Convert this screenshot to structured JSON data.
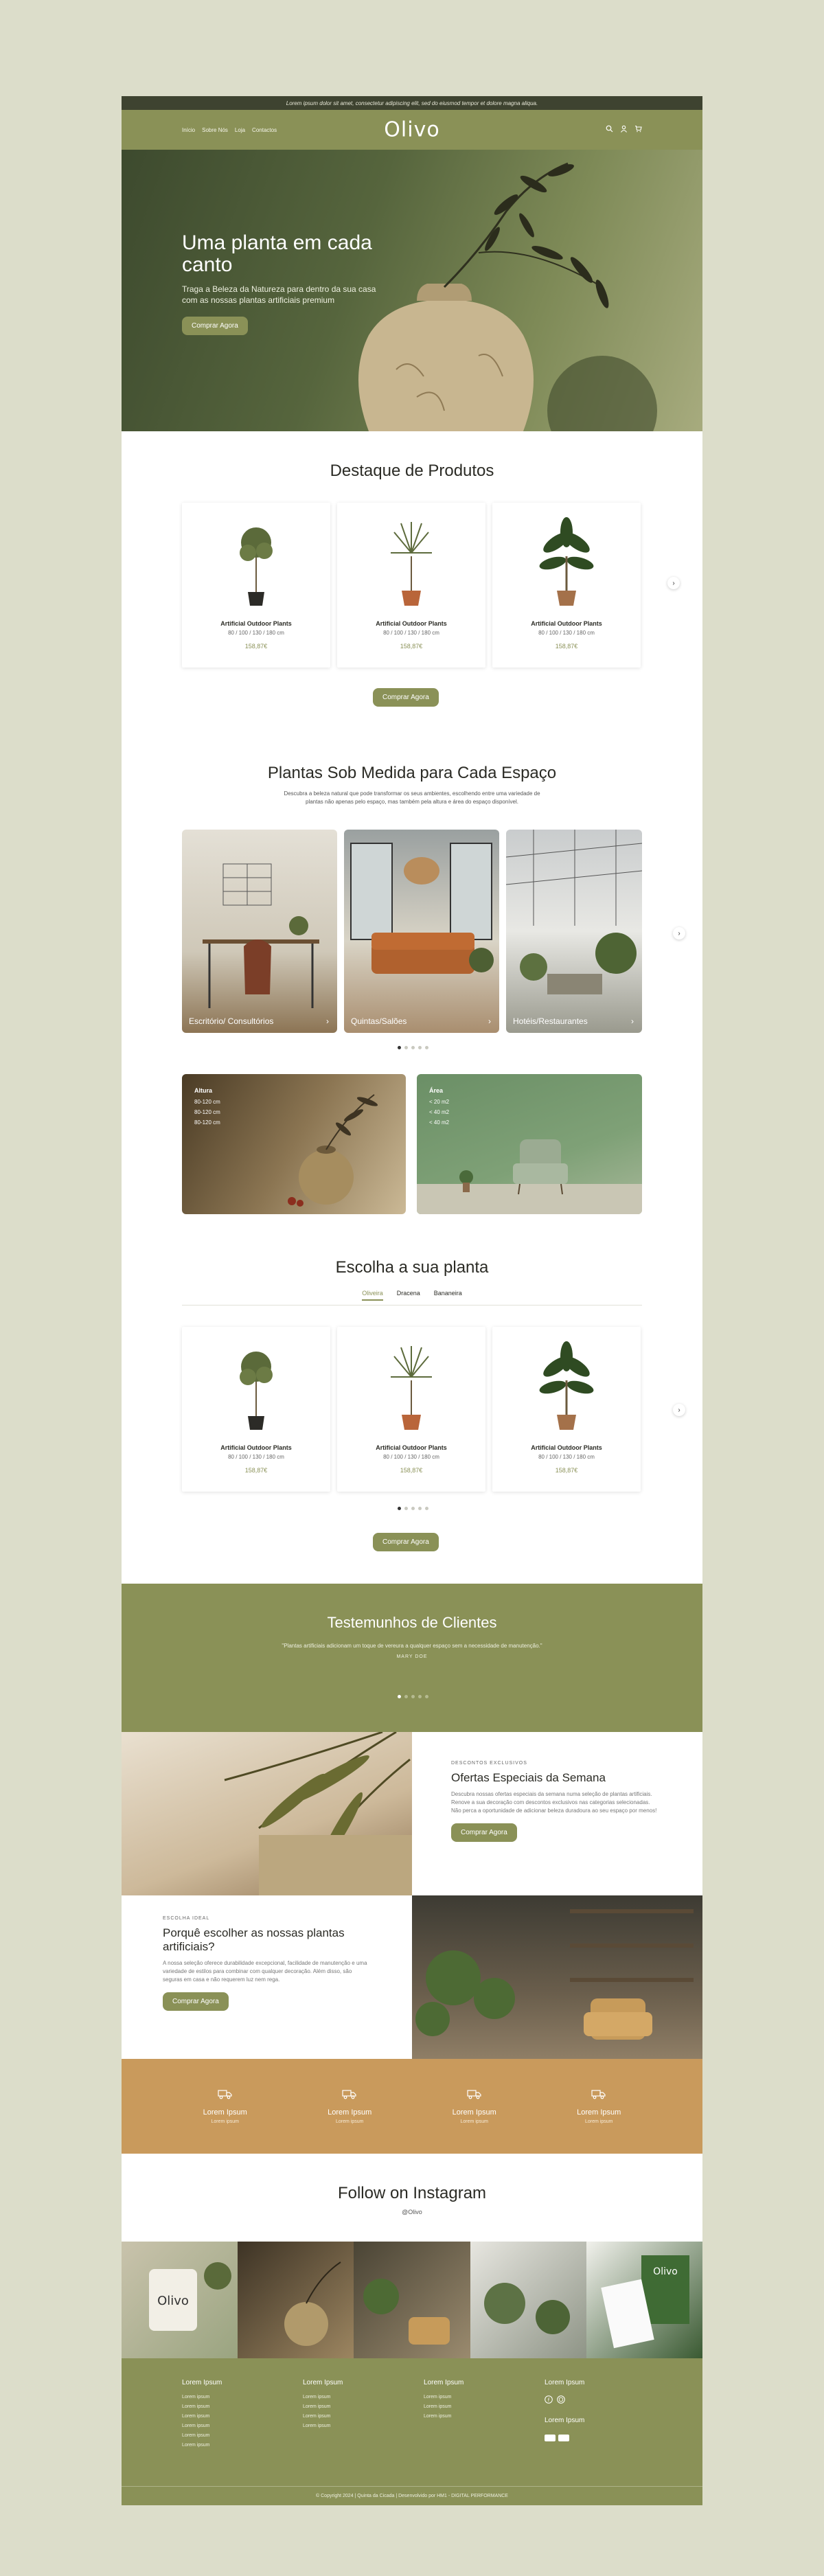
{
  "topbar": {
    "text": "Lorem ipsum dolor sit amet, consectetur adipiscing elit, sed do eiusmod tempor et dolore magna aliqua."
  },
  "nav": {
    "links": [
      "Início",
      "Sobre Nós",
      "Loja",
      "Contactos"
    ],
    "logo": "Olivo",
    "icons": [
      "search-icon",
      "user-icon",
      "cart-icon"
    ]
  },
  "hero": {
    "title": "Uma planta em cada canto",
    "subtitle": "Traga a Beleza da Natureza para dentro da sua casa com as nossas plantas artificiais premium",
    "cta": "Comprar Agora"
  },
  "featured": {
    "title": "Destaque de Produtos",
    "products": [
      {
        "name": "Artificial Outdoor Plants",
        "sizes": "80 / 100 / 130 / 180 cm",
        "price": "158,87€"
      },
      {
        "name": "Artificial Outdoor Plants",
        "sizes": "80 / 100 / 130 / 180 cm",
        "price": "158,87€"
      },
      {
        "name": "Artificial Outdoor Plants",
        "sizes": "80 / 100 / 130 / 180 cm",
        "price": "158,87€"
      }
    ],
    "cta": "Comprar Agora"
  },
  "spaces": {
    "title": "Plantas Sob Medida para Cada Espaço",
    "subtitle": "Descubra a beleza natural que pode transformar os seus ambientes, escolhendo entre uma variedade de plantas não apenas pelo espaço, mas também pela altura e área do espaço disponível.",
    "cards": [
      "Escritório/ Consultórios",
      "Quintas/Salões",
      "Hotéis/Restaurantes"
    ]
  },
  "filters": {
    "height": {
      "title": "Altura",
      "items": [
        "80-120 cm",
        "80-120 cm",
        "80-120 cm"
      ]
    },
    "area": {
      "title": "Área",
      "items": [
        "< 20 m2",
        "< 40 m2",
        "< 40 m2"
      ]
    }
  },
  "choose": {
    "title": "Escolha a sua planta",
    "tabs": [
      "Oliveira",
      "Dracena",
      "Bananeira"
    ],
    "products": [
      {
        "name": "Artificial Outdoor Plants",
        "sizes": "80 / 100 / 130 / 180 cm",
        "price": "158,87€"
      },
      {
        "name": "Artificial Outdoor Plants",
        "sizes": "80 / 100 / 130 / 180 cm",
        "price": "158,87€"
      },
      {
        "name": "Artificial Outdoor Plants",
        "sizes": "80 / 100 / 130 / 180 cm",
        "price": "158,87€"
      }
    ],
    "cta": "Comprar Agora"
  },
  "testimonials": {
    "title": "Testemunhos de Clientes",
    "quote": "\"Plantas artificiais adicionam um toque de vereura a qualquer espaço sem a necessidade de manutenção.\"",
    "author": "MARY DOE"
  },
  "offers": {
    "kicker": "DESCONTOS EXCLUSIVOS",
    "title": "Ofertas Especiais da Semana",
    "desc": "Descubra nossas ofertas especiais da semana numa seleção de plantas artificiais. Renove a sua decoração com descontos exclusivos nas categorias selecionadas. Não perca a oportunidade de adicionar beleza duradoura ao seu espaço por menos!",
    "cta": "Comprar Agora"
  },
  "why": {
    "kicker": "ESCOLHA IDEAL",
    "title": "Porquê escolher as nossas plantas artificiais?",
    "desc": "A nossa seleção oferece durabilidade excepcional, facilidade de manutenção e uma variedade de estilos para combinar com qualquer decoração. Além disso, são seguras em casa e não requerem luz nem rega.",
    "cta": "Comprar Agora"
  },
  "benefits": [
    {
      "title": "Lorem Ipsum",
      "sub": "Lorem ipsum"
    },
    {
      "title": "Lorem Ipsum",
      "sub": "Lorem ipsum"
    },
    {
      "title": "Lorem Ipsum",
      "sub": "Lorem ipsum"
    },
    {
      "title": "Lorem Ipsum",
      "sub": "Lorem ipsum"
    }
  ],
  "instagram": {
    "title": "Follow on Instagram",
    "handle": "@Olivo"
  },
  "footer": {
    "cols": [
      {
        "title": "Lorem Ipsum",
        "links": [
          "Lorem ipsum",
          "Lorem ipsum",
          "Lorem ipsum",
          "Lorem ipsum",
          "Lorem ipsum",
          "Lorem ipsum"
        ]
      },
      {
        "title": "Lorem Ipsum",
        "links": [
          "Lorem ipsum",
          "Lorem ipsum",
          "Lorem ipsum",
          "Lorem ipsum"
        ]
      },
      {
        "title": "Lorem Ipsum",
        "links": [
          "Lorem ipsum",
          "Lorem ipsum",
          "Lorem ipsum"
        ]
      }
    ],
    "social_title": "Lorem Ipsum",
    "payment_title": "Lorem Ipsum",
    "copyright": "© Copyright 2024 | Quinta da Cicada | Desenvolvido por HM1 - DIGITAL PERFORMANCE"
  },
  "colors": {
    "primary": "#8a9157",
    "dark": "#3e4330",
    "tan": "#c99a5c",
    "bg": "#dcddca"
  }
}
